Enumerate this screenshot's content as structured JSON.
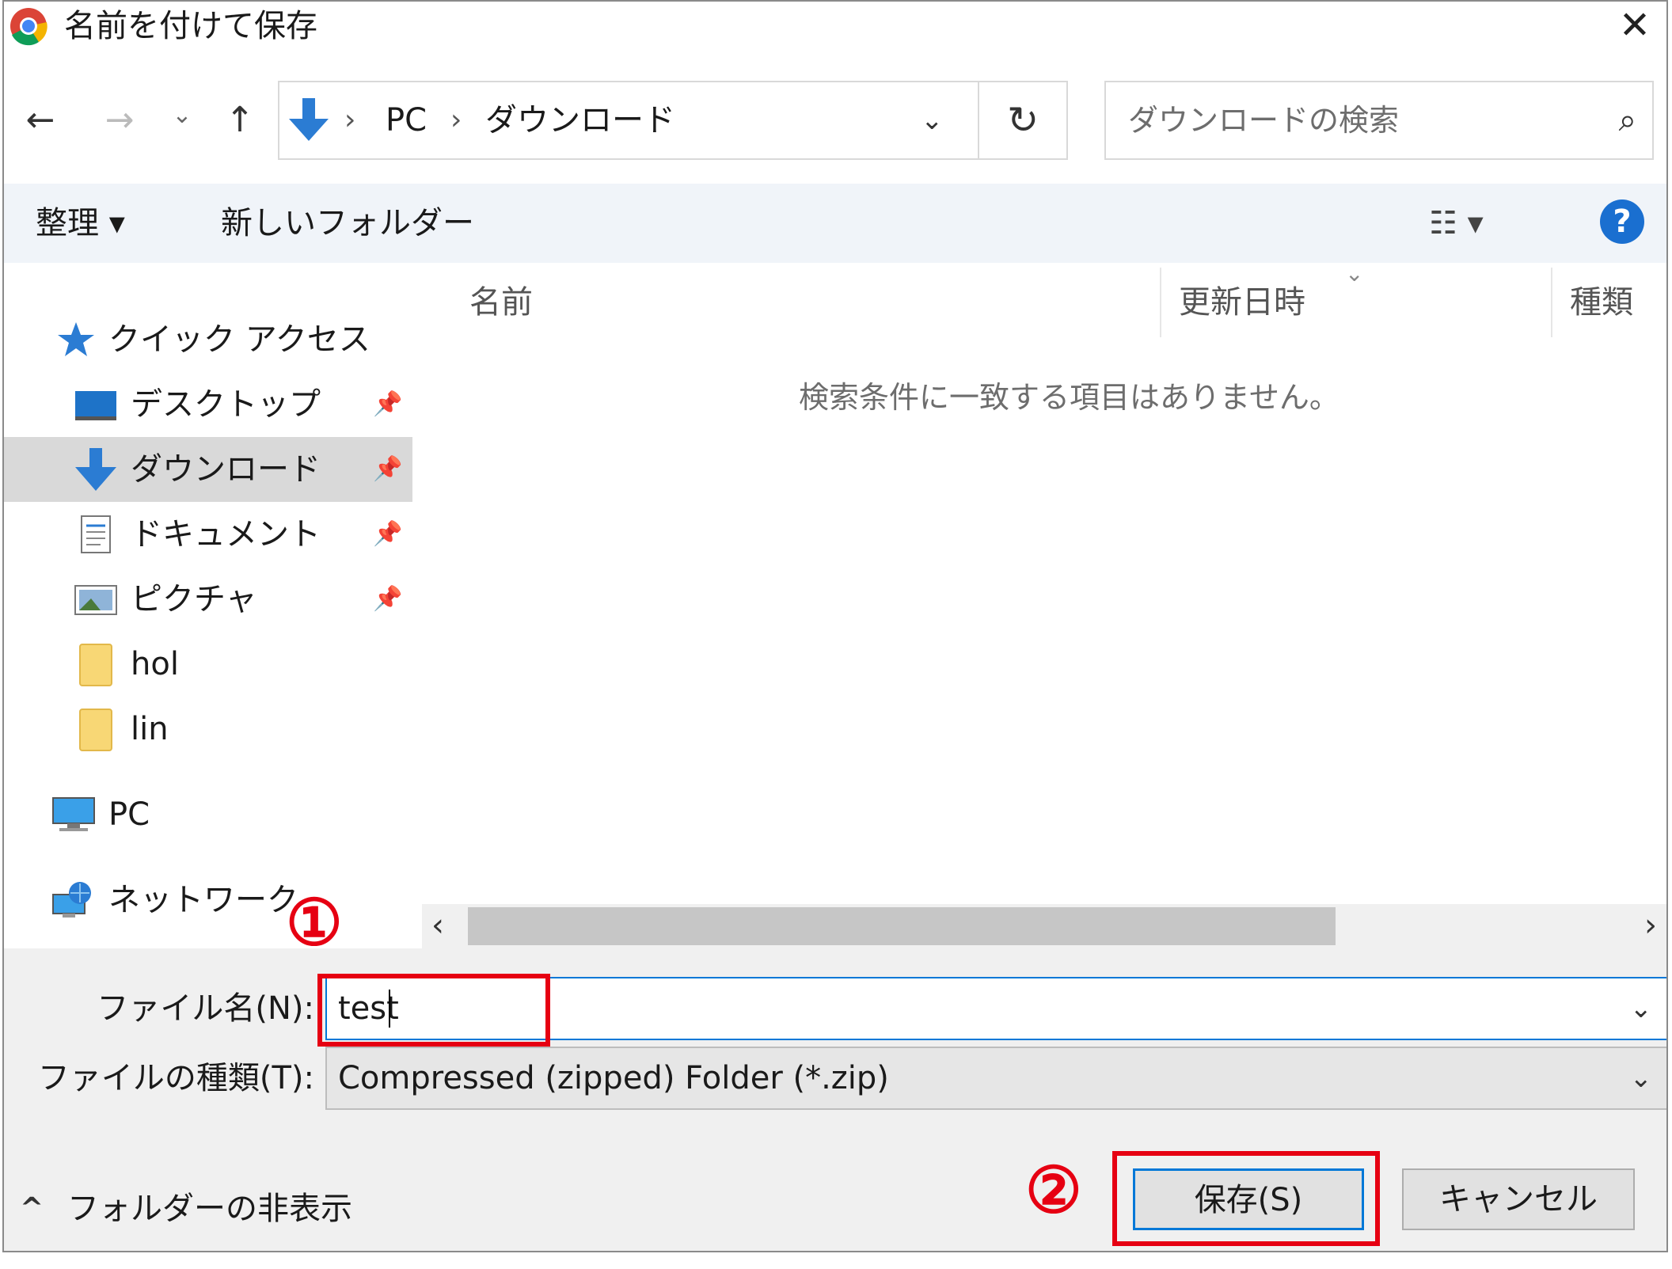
{
  "titlebar": {
    "title": "名前を付けて保存",
    "close_glyph": "✕"
  },
  "nav": {
    "back_glyph": "←",
    "forward_glyph": "→",
    "recent_glyph": "⌄",
    "up_glyph": "↑",
    "breadcrumb": [
      "PC",
      "ダウンロード"
    ],
    "breadcrumb_sep": "›",
    "address_dropdown_glyph": "⌄",
    "refresh_glyph": "↻",
    "search_placeholder": "ダウンロードの検索",
    "search_glyph": "⌕"
  },
  "toolbar": {
    "organize_label": "整理 ▾",
    "new_folder_label": "新しいフォルダー",
    "view_glyph": "☷ ▾",
    "help_glyph": "?"
  },
  "sidebar": {
    "items": [
      {
        "label": "クイック アクセス",
        "icon": "star-icon"
      },
      {
        "label": "デスクトップ",
        "icon": "desktop-icon",
        "pinned": true
      },
      {
        "label": "ダウンロード",
        "icon": "download-icon",
        "pinned": true,
        "selected": true
      },
      {
        "label": "ドキュメント",
        "icon": "document-icon",
        "pinned": true
      },
      {
        "label": "ピクチャ",
        "icon": "picture-icon",
        "pinned": true
      },
      {
        "label": "hol",
        "icon": "folder-icon"
      },
      {
        "label": "lin",
        "icon": "folder-icon"
      },
      {
        "label": "PC",
        "icon": "pc-icon"
      },
      {
        "label": "ネットワーク",
        "icon": "network-icon"
      }
    ],
    "pin_glyph": "📌"
  },
  "content": {
    "columns": [
      "名前",
      "更新日時",
      "種類"
    ],
    "sort_glyph": "⌄",
    "empty_message": "検索条件に一致する項目はありません。",
    "scroll_left_glyph": "‹",
    "scroll_right_glyph": "›"
  },
  "form": {
    "filename_label": "ファイル名(N):",
    "filename_value": "test",
    "filetype_label": "ファイルの種類(T):",
    "filetype_value": "Compressed (zipped) Folder (*.zip)",
    "dropdown_glyph": "⌄",
    "hide_folders_label": "フォルダーの非表示",
    "hide_folders_glyph": "^",
    "save_label": "保存(S)",
    "cancel_label": "キャンセル"
  },
  "annotations": {
    "step1": "①",
    "step2": "②",
    "color": "#e60012"
  }
}
